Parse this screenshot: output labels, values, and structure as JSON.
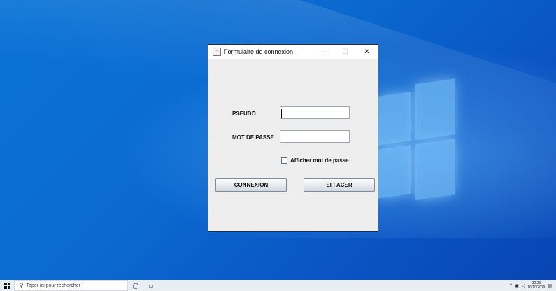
{
  "window": {
    "title": "Formulaire de connexion",
    "controls": {
      "minimize": "—",
      "maximize": "☐",
      "close": "✕"
    }
  },
  "form": {
    "pseudo_label": "PSEUDO",
    "pseudo_value": "",
    "password_label": "MOT DE PASSE",
    "password_value": "",
    "show_password_label": "Afficher mot de passe",
    "show_password_checked": false,
    "connect_button": "CONNEXION",
    "clear_button": "EFFACER"
  },
  "taskbar": {
    "search_placeholder": "Taper ici pour rechercher",
    "time": "22:23",
    "date": "16/10/2019"
  },
  "colors": {
    "desktop": "#0a6ad0",
    "window_bg": "#eeeeee",
    "taskbar": "#e9eef5"
  }
}
